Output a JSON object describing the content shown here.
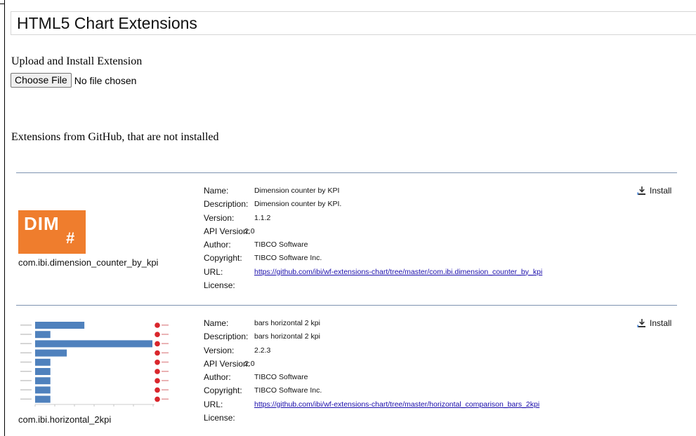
{
  "page": {
    "title": "HTML5 Chart Extensions"
  },
  "upload": {
    "label": "Upload and Install Extension",
    "button_label": "Choose File",
    "status": "No file chosen"
  },
  "github_section": {
    "label": "Extensions from GitHub, that are not installed"
  },
  "field_labels": {
    "name": "Name:",
    "description": "Description:",
    "version": "Version:",
    "api_version": "API Version:",
    "author": "Author:",
    "copyright": "Copyright:",
    "url": "URL:",
    "license": "License:"
  },
  "extensions": [
    {
      "id": "com.ibi.dimension_counter_by_kpi",
      "logo_text": "DIM",
      "logo_symbol": "#",
      "logo_color": "#ef7d2d",
      "name": "Dimension counter by KPI",
      "description": "Dimension counter by KPI.",
      "version": "1.1.2",
      "api_version": "2.0",
      "author": "TIBCO Software",
      "copyright": "TIBCO Software Inc.",
      "url": "https://github.com/ibi/wf-extensions-chart/tree/master/com.ibi.dimension_counter_by_kpi",
      "license": "",
      "install_label": "Install"
    },
    {
      "id": "com.ibi.horizontal_2kpi",
      "name": "bars horizontal 2 kpi",
      "description": "bars horizontal 2 kpi",
      "version": "2.2.3",
      "api_version": "2.0",
      "author": "TIBCO Software",
      "copyright": "TIBCO Software Inc.",
      "url": "https://github.com/ibi/wf-extensions-chart/tree/master/horizontal_comparison_bars_2kpi",
      "license": "",
      "install_label": "Install",
      "thumbnail_bar_values": [
        0.42,
        0.13,
        1.0,
        0.27,
        0.13,
        0.13,
        0.13,
        0.13,
        0.13
      ],
      "thumbnail_bar_color": "#4f81bd",
      "thumbnail_marker_color": "#d9262c"
    }
  ],
  "colors": {
    "separator": "#7d93b0",
    "link": "#1a0dab"
  }
}
